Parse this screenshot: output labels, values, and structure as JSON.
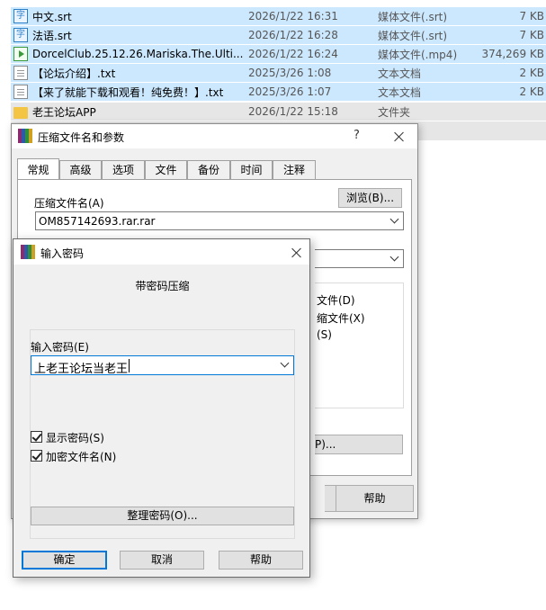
{
  "files": [
    {
      "name": "中文.srt",
      "date": "2026/1/22 16:31",
      "type": "媒体文件(.srt)",
      "size": "7 KB",
      "icon": "srt"
    },
    {
      "name": "法语.srt",
      "date": "2026/1/22 16:28",
      "type": "媒体文件(.srt)",
      "size": "7 KB",
      "icon": "srt"
    },
    {
      "name": "DorcelClub.25.12.26.Mariska.The.Ulti...",
      "date": "2026/1/22 16:24",
      "type": "媒体文件(.mp4)",
      "size": "374,269 KB",
      "icon": "mp4"
    },
    {
      "name": "【论坛介绍】.txt",
      "date": "2025/3/26 1:08",
      "type": "文本文档",
      "size": "2 KB",
      "icon": "txt"
    },
    {
      "name": "【来了就能下载和观看！纯免费！】.txt",
      "date": "2025/3/26 1:07",
      "type": "文本文档",
      "size": "2 KB",
      "icon": "txt"
    },
    {
      "name": "老王论坛APP",
      "date": "2026/1/22 15:18",
      "type": "文件夹",
      "size": "",
      "icon": "folder"
    }
  ],
  "archive_dialog": {
    "title": "压缩文件名和参数",
    "help_glyph": "?",
    "tabs": [
      "常规",
      "高级",
      "选项",
      "文件",
      "备份",
      "时间",
      "注释"
    ],
    "archive_name_label": "压缩文件名(A)",
    "browse_label": "浏览(B)...",
    "archive_name_value": "OM857142693.rar.rar",
    "opt_partial_1": "文件(D)",
    "opt_partial_2": "缩文件(X)",
    "opt_partial_3": "(S)",
    "set_password_partial": "P)...",
    "help_label": "帮助"
  },
  "password_dialog": {
    "title": "输入密码",
    "heading": "带密码压缩",
    "password_label": "输入密码(E)",
    "password_value": "上老王论坛当老王",
    "show_password_label": "显示密码(S)",
    "show_password_checked": true,
    "encrypt_names_label": "加密文件名(N)",
    "encrypt_names_checked": true,
    "organize_label": "整理密码(O)...",
    "ok_label": "确定",
    "cancel_label": "取消",
    "help_label": "帮助"
  },
  "colors": {
    "selection": "#cce8ff",
    "accent": "#0078d7",
    "dialog_bg": "#f0f0f0"
  }
}
